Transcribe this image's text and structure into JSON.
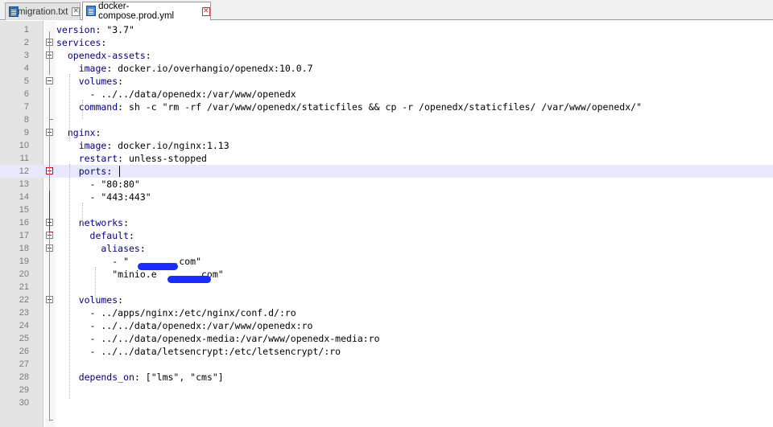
{
  "tabs": [
    {
      "label": "migration.txt",
      "close": "✕"
    },
    {
      "label": "docker-compose.prod.yml",
      "close": "✕"
    }
  ],
  "editor": {
    "lines": [
      {
        "num": "1",
        "key": "version",
        "rest": " \"3.7\""
      },
      {
        "num": "2",
        "key": "services",
        "rest": ""
      },
      {
        "num": "3",
        "key": "  openedx-assets",
        "rest": ""
      },
      {
        "num": "4",
        "key": "    image",
        "rest": " docker.io/overhangio/openedx:10.0.7"
      },
      {
        "num": "5",
        "key": "    volumes",
        "rest": ""
      },
      {
        "num": "6",
        "key": "",
        "rest": "      - ../../data/openedx:/var/www/openedx"
      },
      {
        "num": "7",
        "key": "    command",
        "rest": " sh -c \"rm -rf /var/www/openedx/staticfiles && cp -r /openedx/staticfiles/ /var/www/openedx/\""
      },
      {
        "num": "8",
        "key": "",
        "rest": ""
      },
      {
        "num": "9",
        "key": "  nginx",
        "rest": ""
      },
      {
        "num": "10",
        "key": "    image",
        "rest": " docker.io/nginx:1.13"
      },
      {
        "num": "11",
        "key": "    restart",
        "rest": " unless-stopped"
      },
      {
        "num": "12",
        "key": "    ports",
        "rest": ""
      },
      {
        "num": "13",
        "key": "",
        "rest": "      - \"80:80\""
      },
      {
        "num": "14",
        "key": "",
        "rest": "      - \"443:443\""
      },
      {
        "num": "15",
        "key": "",
        "rest": ""
      },
      {
        "num": "16",
        "key": "    networks",
        "rest": ""
      },
      {
        "num": "17",
        "key": "      default",
        "rest": ""
      },
      {
        "num": "18",
        "key": "        aliases",
        "rest": ""
      },
      {
        "num": "19",
        "key": "",
        "rest": "          - \"        .com\""
      },
      {
        "num": "20",
        "key": "",
        "rest": "          \"minio.e       .com\""
      },
      {
        "num": "21",
        "key": "",
        "rest": ""
      },
      {
        "num": "22",
        "key": "    volumes",
        "rest": ""
      },
      {
        "num": "23",
        "key": "",
        "rest": "      - ../apps/nginx:/etc/nginx/conf.d/:ro"
      },
      {
        "num": "24",
        "key": "",
        "rest": "      - ../../data/openedx:/var/www/openedx:ro"
      },
      {
        "num": "25",
        "key": "",
        "rest": "      - ../../data/openedx-media:/var/www/openedx-media:ro"
      },
      {
        "num": "26",
        "key": "",
        "rest": "      - ../../data/letsencrypt:/etc/letsencrypt/:ro"
      },
      {
        "num": "27",
        "key": "",
        "rest": ""
      },
      {
        "num": "28",
        "key": "    depends_on",
        "rest": " [\"lms\", \"cms\"]"
      },
      {
        "num": "29",
        "key": "",
        "rest": ""
      },
      {
        "num": "30",
        "key": "",
        "rest": ""
      }
    ]
  },
  "colors": {
    "keyword": "#000080",
    "current_line": "#e8e8ff",
    "redaction": "#1a2cff"
  }
}
